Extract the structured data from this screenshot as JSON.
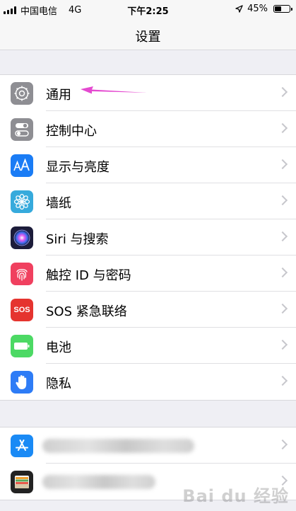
{
  "status_bar": {
    "carrier": "中国电信",
    "network": "4G",
    "time": "下午2:25",
    "battery_percent": "45%",
    "battery_level": 0.45,
    "location_icon": "location-arrow-icon"
  },
  "nav": {
    "title": "设置"
  },
  "colors": {
    "background": "#efeff4",
    "annotation_arrow": "#e44ad0"
  },
  "settings_group": {
    "items": [
      {
        "label": "通用",
        "icon": "gear-icon",
        "icon_color": "#8e8e93"
      },
      {
        "label": "控制中心",
        "icon": "toggles-icon",
        "icon_color": "#8e8e93"
      },
      {
        "label": "显示与亮度",
        "icon": "aa-display-icon",
        "icon_color": "#1a7cf5"
      },
      {
        "label": "墙纸",
        "icon": "flower-icon",
        "icon_color": "#36aadc"
      },
      {
        "label": "Siri 与搜索",
        "icon": "siri-icon",
        "icon_color": "#1c1c3a"
      },
      {
        "label": "触控 ID 与密码",
        "icon": "fingerprint-icon",
        "icon_color": "#f0405f"
      },
      {
        "label": "SOS 紧急联络",
        "icon": "sos-icon",
        "icon_color": "#e5342f",
        "icon_text": "SOS"
      },
      {
        "label": "电池",
        "icon": "battery-icon",
        "icon_color": "#4cd964"
      },
      {
        "label": "隐私",
        "icon": "hand-icon",
        "icon_color": "#2e7cf6"
      }
    ]
  },
  "apps_group": {
    "items": [
      {
        "icon": "app-store-icon",
        "icon_color": "#1a8af5"
      },
      {
        "icon": "wallet-icon",
        "icon_color": "#222222"
      }
    ]
  },
  "watermark": "Bai du 经验"
}
